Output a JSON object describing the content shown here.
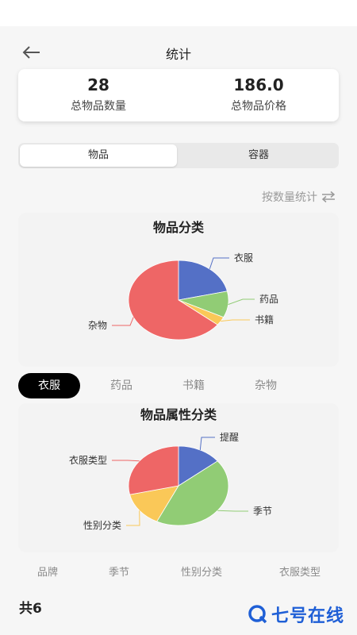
{
  "header": {
    "title": "统计",
    "back_icon": "arrow-left-icon"
  },
  "summary": {
    "total_count_value": "28",
    "total_count_label": "总物品数量",
    "total_price_value": "186.0",
    "total_price_label": "总物品价格"
  },
  "segment": {
    "items_label": "物品",
    "containers_label": "容器",
    "selected": "物品"
  },
  "sort": {
    "label": "按数量统计",
    "icon": "swap-arrows-icon"
  },
  "chart1_title": "物品分类",
  "category_chips": [
    "衣服",
    "药品",
    "书籍",
    "杂物"
  ],
  "selected_chip": "衣服",
  "chart2_title": "物品属性分类",
  "attr_tabs": [
    "品牌",
    "季节",
    "性别分类",
    "衣服类型"
  ],
  "total_label": "共6",
  "watermark": {
    "text": "七号在线",
    "icon": "q-logo-icon"
  },
  "colors": {
    "blue": "#5470c6",
    "green": "#91cc75",
    "yellow": "#fac858",
    "red": "#ee6666"
  },
  "chart_data": [
    {
      "type": "pie",
      "title": "物品分类",
      "categories": [
        "衣服",
        "药品",
        "书籍",
        "杂物"
      ],
      "values": [
        6,
        3,
        1,
        18
      ]
    },
    {
      "type": "pie",
      "title": "物品属性分类",
      "categories": [
        "提醒",
        "季节",
        "性别分类",
        "衣服类型"
      ],
      "values": [
        1,
        3,
        1,
        2
      ]
    }
  ]
}
